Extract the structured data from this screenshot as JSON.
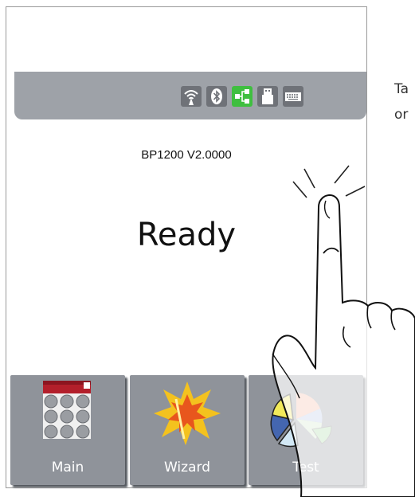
{
  "app": {
    "version": "BP1200 V2.0000",
    "status": "Ready",
    "side_text_line1": "Ta",
    "side_text_line2": "or"
  },
  "status_bar": {
    "icons": [
      "wireless-icon",
      "bluetooth-icon",
      "network-icon",
      "usb-icon",
      "keyboard-icon"
    ],
    "active_icon": "network-icon",
    "colors": {
      "bar": "#9ea2a8",
      "icon_bg": "#6f7278",
      "active": "#3fbf3f"
    }
  },
  "tiles": [
    {
      "label": "Main",
      "icon": "grid-calendar-icon"
    },
    {
      "label": "Wizard",
      "icon": "starburst-icon"
    },
    {
      "label": "Test",
      "icon": "pie-chart-icon"
    }
  ],
  "overlay": {
    "icon": "tapping-hand-icon"
  }
}
